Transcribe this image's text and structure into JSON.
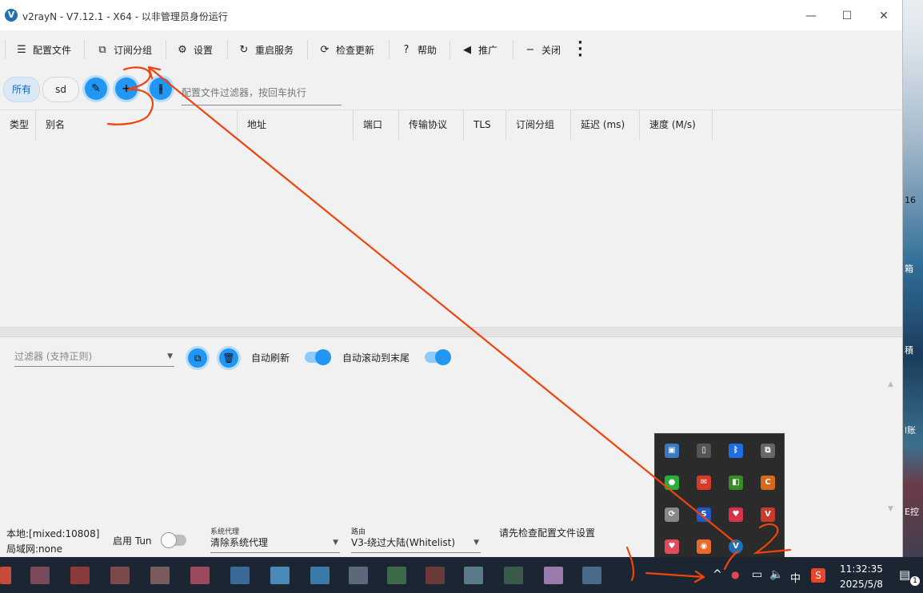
{
  "window": {
    "title": "v2rayN - V7.12.1 - X64 - 以非管理员身份运行",
    "icon_letter": "V",
    "minimize_glyph": "—",
    "maximize_glyph": "☐",
    "close_glyph": "✕"
  },
  "toolbar": {
    "profiles": "配置文件",
    "sub_groups": "订阅分组",
    "settings": "设置",
    "restart": "重启服务",
    "check_update": "检查更新",
    "help": "帮助",
    "promote": "推广",
    "close": "关闭"
  },
  "filter_bar": {
    "chip_all": "所有",
    "chip_sd": "sd",
    "filter_placeholder": "配置文件过滤器，按回车执行"
  },
  "grid": {
    "columns": [
      "类型",
      "别名",
      "地址",
      "端口",
      "传输协议",
      "TLS",
      "订阅分组",
      "延迟 (ms)",
      "速度 (M/s)"
    ]
  },
  "log_bar": {
    "filter_placeholder": "过滤器 (支持正则)",
    "auto_refresh": "自动刷新",
    "auto_refresh_on": true,
    "auto_scroll": "自动滚动到末尾",
    "auto_scroll_on": true
  },
  "status": {
    "local": "本地:[mixed:10808]",
    "lan": "局域网:none",
    "tun_label": "启用 Tun",
    "tun_on": false,
    "sys_proxy_caption": "系统代理",
    "sys_proxy_value": "清除系统代理",
    "routing_caption": "路由",
    "routing_value": "V3-绕过大陆(Whitelist)",
    "message": "请先检查配置文件设置"
  },
  "taskbar": {
    "ime": "中",
    "time": "11:32:35",
    "date": "2025/5/8",
    "notification_count": "1"
  },
  "desktop": {
    "text_16": "16",
    "text_xiang": "箱",
    "text_ji": "積",
    "text_zhang": "l账",
    "text_kong": "E控"
  },
  "accent_color": "#2196f3"
}
